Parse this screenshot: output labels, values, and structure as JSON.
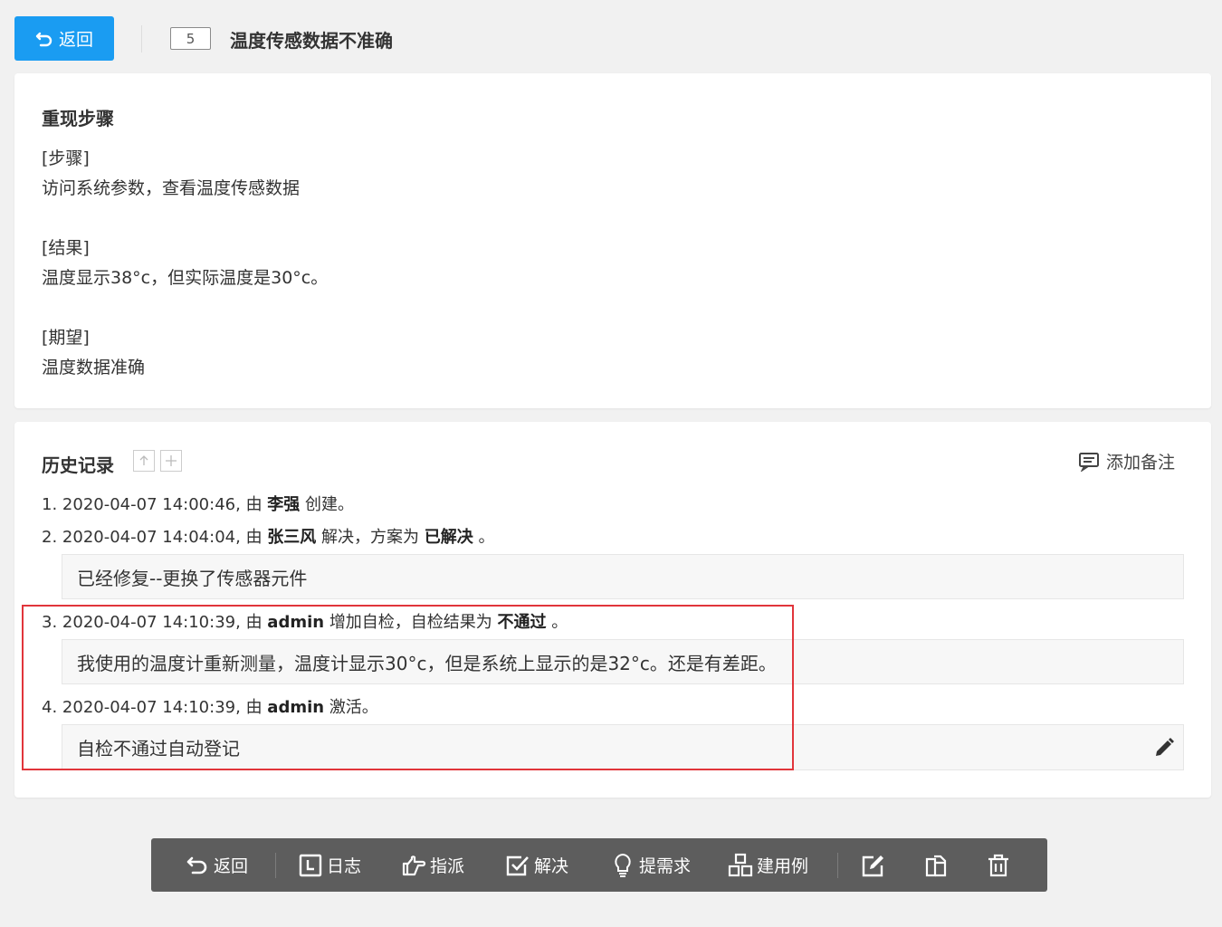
{
  "header": {
    "back_label": "返回",
    "id": "5",
    "title": "温度传感数据不准确"
  },
  "steps_section": {
    "title": "重现步骤",
    "lines": [
      "[步骤]",
      "访问系统参数，查看温度传感数据",
      "[结果]",
      "温度显示38°c，但实际温度是30°c。",
      "[期望]",
      "温度数据准确"
    ]
  },
  "history": {
    "title": "历史记录",
    "add_note_label": "添加备注",
    "entries": [
      {
        "num": "1.",
        "time": "2020-04-07 14:00:46,",
        "by": "由",
        "user": "李强",
        "action": "创建。"
      },
      {
        "num": "2.",
        "time": "2020-04-07 14:04:04,",
        "by": "由",
        "user": "张三风",
        "action": "解决，方案为",
        "result": "已解决",
        "end": "。",
        "comment": "已经修复--更换了传感器元件"
      },
      {
        "num": "3.",
        "time": "2020-04-07 14:10:39,",
        "by": "由",
        "user": "admin",
        "action": "增加自检，自检结果为",
        "result": "不通过",
        "end": "。",
        "comment": "我使用的温度计重新测量，温度计显示30°c，但是系统上显示的是32°c。还是有差距。"
      },
      {
        "num": "4.",
        "time": "2020-04-07 14:10:39,",
        "by": "由",
        "user": "admin",
        "action": "激活。",
        "comment": "自检不通过自动登记"
      }
    ]
  },
  "toolbar": {
    "back": "返回",
    "log": "日志",
    "assign": "指派",
    "resolve": "解决",
    "story": "提需求",
    "testcase": "建用例"
  },
  "colors": {
    "primary": "#1a9cf2",
    "toolbar_bg": "#5d5d5d",
    "highlight_border": "#e1353b"
  }
}
